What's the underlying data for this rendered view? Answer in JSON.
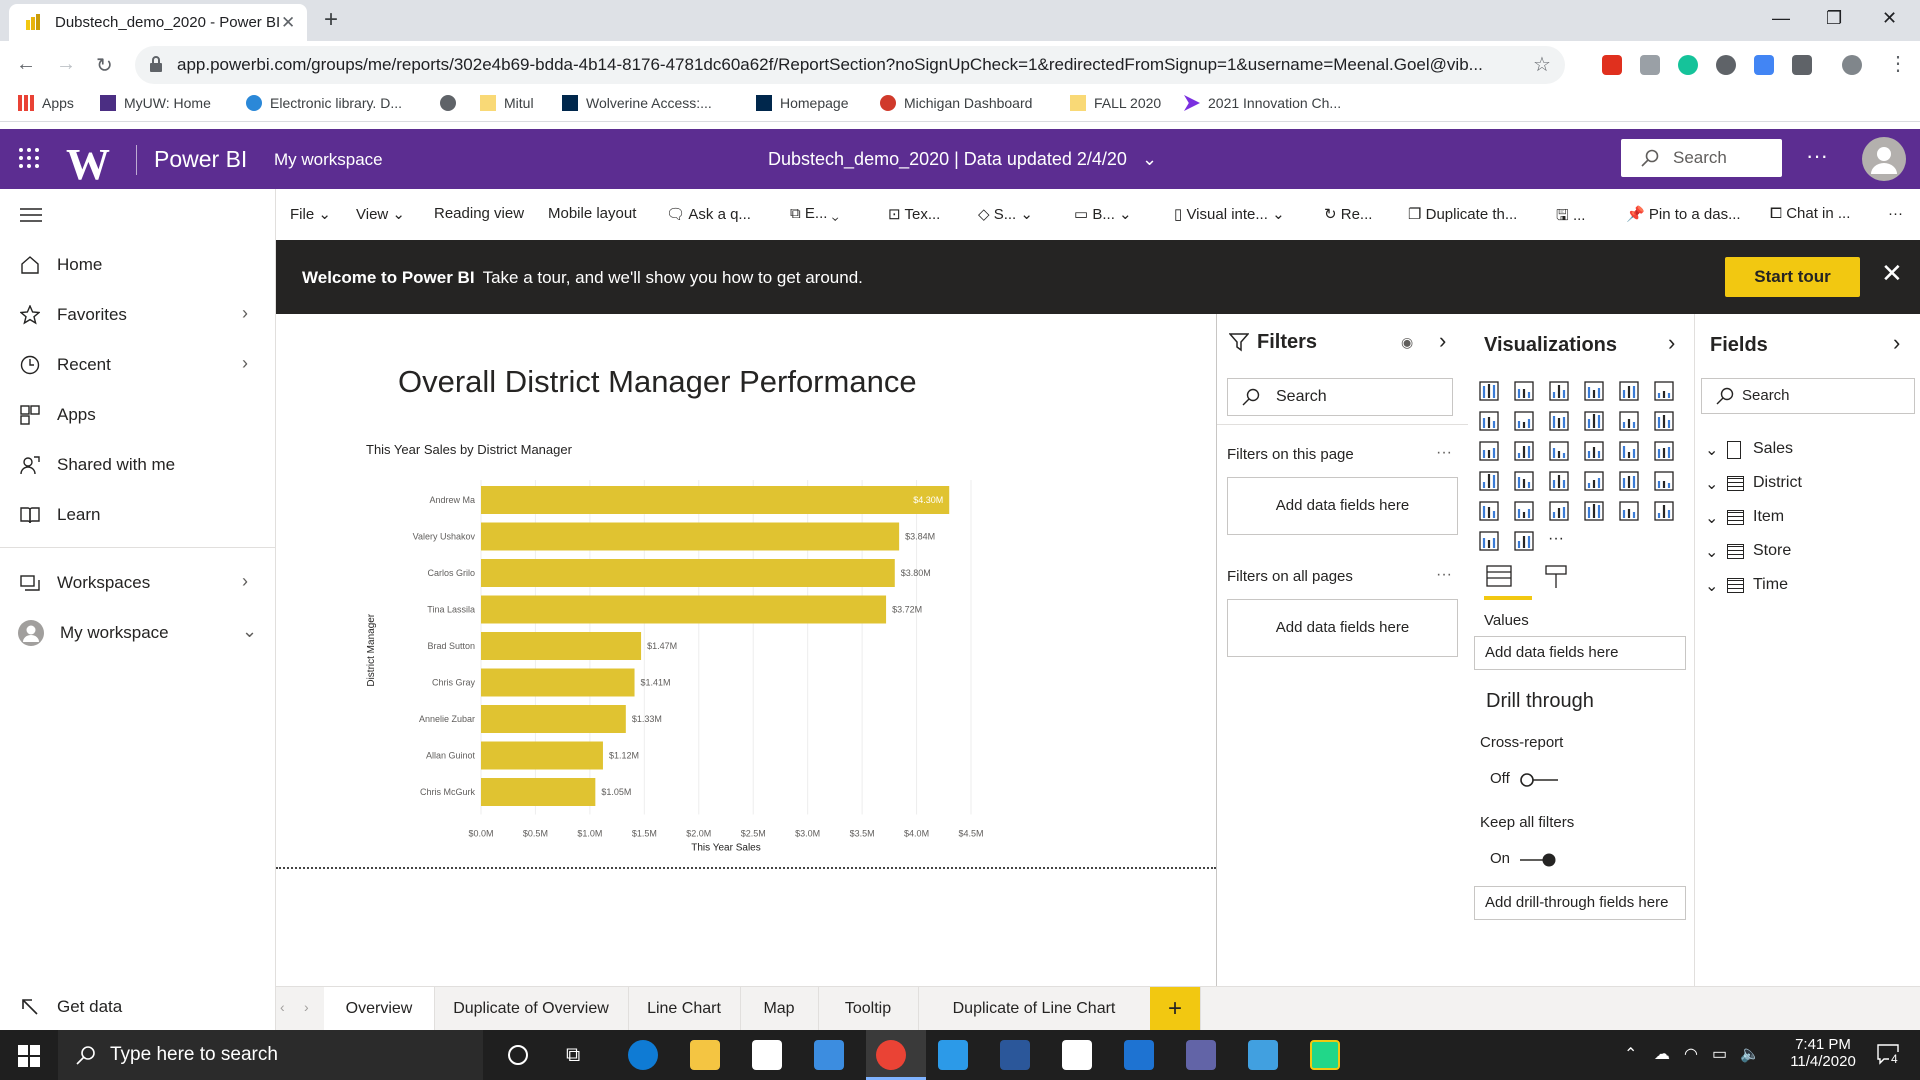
{
  "browser": {
    "tab_title": "Dubstech_demo_2020 - Power BI",
    "url": "app.powerbi.com/groups/me/reports/302e4b69-bdda-4b14-8176-4781dc60a62f/ReportSection?noSignUpCheck=1&redirectedFromSignup=1&username=Meenal.Goel@vib...",
    "bookmarks": [
      "Apps",
      "MyUW: Home",
      "Electronic library. D...",
      "Mitul",
      "Wolverine Access:...",
      "Homepage",
      "Michigan Dashboard",
      "FALL 2020",
      "2021 Innovation Ch..."
    ]
  },
  "header": {
    "logo_letter": "W",
    "product": "Power BI",
    "workspace": "My workspace",
    "report_title": "Dubstech_demo_2020  |  Data updated 2/4/20",
    "search_placeholder": "Search",
    "more": "···"
  },
  "nav": {
    "items": [
      {
        "label": "Home",
        "chevron": ""
      },
      {
        "label": "Favorites",
        "chevron": "›"
      },
      {
        "label": "Recent",
        "chevron": "›"
      },
      {
        "label": "Apps",
        "chevron": ""
      },
      {
        "label": "Shared with me",
        "chevron": ""
      },
      {
        "label": "Learn",
        "chevron": ""
      },
      {
        "label": "Workspaces",
        "chevron": "›"
      },
      {
        "label": "My workspace",
        "chevron": "⌄"
      }
    ],
    "get_data": "Get data"
  },
  "toolbar": {
    "items": [
      "File",
      "View",
      "Reading view",
      "Mobile layout",
      "Ask a q...",
      "E...",
      "Tex...",
      "S...",
      "B...",
      "Visual inte...",
      "Re...",
      "Duplicate th...",
      "...",
      "Pin to a das...",
      "Chat in ...",
      "···"
    ]
  },
  "banner": {
    "bold": "Welcome to Power BI",
    "text": "Take a tour, and we'll show you how to get around.",
    "button": "Start tour",
    "close": "✕"
  },
  "report": {
    "title": "Overall District Manager Performance"
  },
  "chart_data": {
    "type": "bar",
    "orientation": "horizontal",
    "title": "This Year Sales by District Manager",
    "xlabel": "This Year Sales",
    "ylabel": "District Manager",
    "categories": [
      "Andrew Ma",
      "Valery Ushakov",
      "Carlos Grilo",
      "Tina Lassila",
      "Brad Sutton",
      "Chris Gray",
      "Annelie Zubar",
      "Allan Guinot",
      "Chris McGurk"
    ],
    "values": [
      4.3,
      3.84,
      3.8,
      3.72,
      1.47,
      1.41,
      1.33,
      1.12,
      1.05
    ],
    "data_labels": [
      "$4.30M",
      "$3.84M",
      "$3.80M",
      "$3.72M",
      "$1.47M",
      "$1.41M",
      "$1.33M",
      "$1.12M",
      "$1.05M"
    ],
    "xticks": [
      0,
      0.5,
      1.0,
      1.5,
      2.0,
      2.5,
      3.0,
      3.5,
      4.0,
      4.5
    ],
    "xtick_labels": [
      "$0.0M",
      "$0.5M",
      "$1.0M",
      "$1.5M",
      "$2.0M",
      "$2.5M",
      "$3.0M",
      "$3.5M",
      "$4.0M",
      "$4.5M"
    ],
    "xlim": [
      0,
      4.5
    ],
    "bar_color": "#e0c331",
    "grid": true
  },
  "filters": {
    "title": "Filters",
    "search_placeholder": "Search",
    "on_this_page": "Filters on this page",
    "on_all_pages": "Filters on all pages",
    "add_fields": "Add data fields here",
    "more": "···"
  },
  "visualizations": {
    "title": "Visualizations",
    "values_label": "Values",
    "add_fields": "Add data fields here",
    "drill_through": "Drill through",
    "cross_report": "Cross-report",
    "cross_report_state": "Off",
    "keep_all_filters": "Keep all filters",
    "keep_all_filters_state": "On",
    "add_drill": "Add drill-through fields here",
    "more_icons": "···"
  },
  "fields": {
    "title": "Fields",
    "search_placeholder": "Search",
    "tables": [
      "Sales",
      "District",
      "Item",
      "Store",
      "Time"
    ]
  },
  "pages": {
    "tabs": [
      "Overview",
      "Duplicate of Overview",
      "Line Chart",
      "Map",
      "Tooltip",
      "Duplicate of Line Chart"
    ],
    "add": "+"
  },
  "taskbar": {
    "search_placeholder": "Type here to search",
    "time": "7:41 PM",
    "date": "11/4/2020",
    "notifications": "4"
  },
  "colors": {
    "header_purple": "#5c2d91",
    "accent_yellow": "#f2c811",
    "bar_yellow": "#e0c331"
  }
}
